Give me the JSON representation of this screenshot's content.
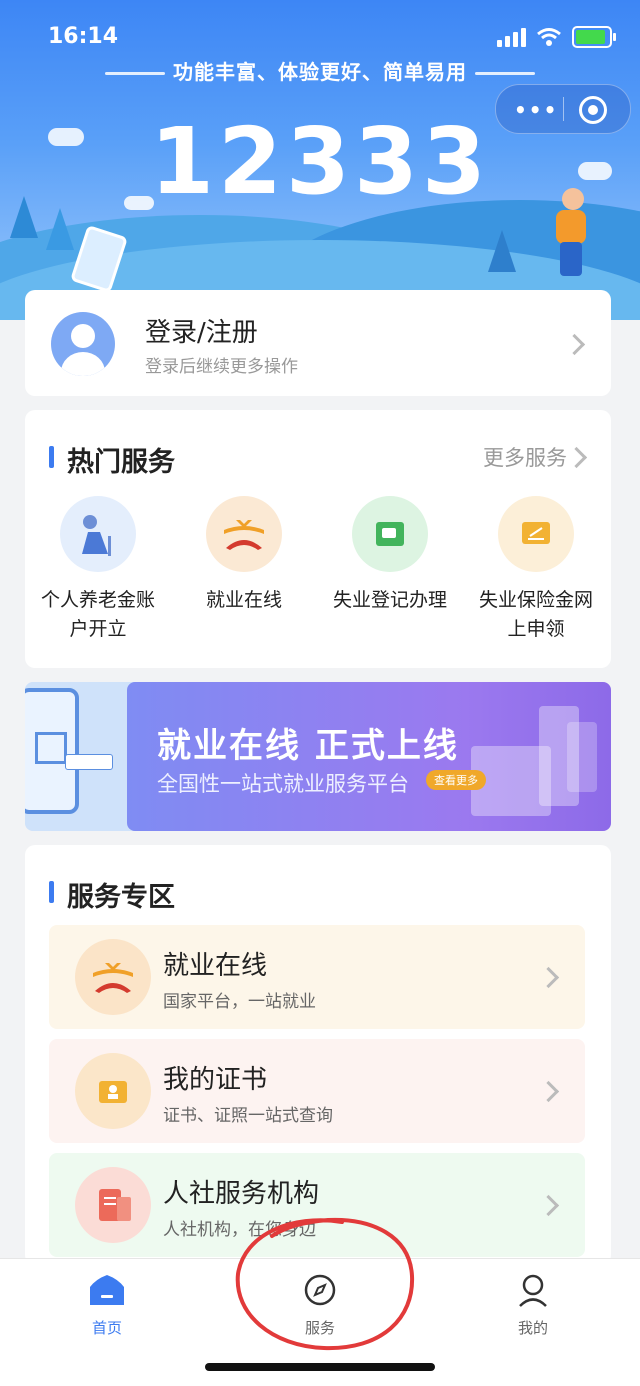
{
  "status_bar": {
    "time": "16:14"
  },
  "header": {
    "tagline": "功能丰富、体验更好、简单易用",
    "hotline": "12333",
    "capsule_dots": "•••"
  },
  "login": {
    "title": "登录/注册",
    "subtitle": "登录后继续更多操作"
  },
  "hot_services": {
    "title": "热门服务",
    "more": "更多服务",
    "items": [
      {
        "line1": "个人养老金账",
        "line2": "户开立",
        "icon": "elderly-person-icon"
      },
      {
        "line1": "就业在线",
        "line2": "",
        "icon": "employment-logo-icon"
      },
      {
        "line1": "失业登记办理",
        "line2": "",
        "icon": "wallet-icon"
      },
      {
        "line1": "失业保险金网",
        "line2": "上申领",
        "icon": "document-icon"
      }
    ]
  },
  "banner": {
    "headline": "就业在线  正式上线",
    "subline": "全国性一站式就业服务平台",
    "button": "查看更多"
  },
  "service_zone": {
    "title": "服务专区",
    "items": [
      {
        "title": "就业在线",
        "subtitle": "国家平台，一站就业",
        "icon": "employment-logo-icon",
        "bg": "#fdf6e9"
      },
      {
        "title": "我的证书",
        "subtitle": "证书、证照一站式查询",
        "icon": "certificate-icon",
        "bg": "#fdf3f1"
      },
      {
        "title": "人社服务机构",
        "subtitle": "人社机构，在您身边",
        "icon": "institution-icon",
        "bg": "#eefaf0"
      }
    ]
  },
  "tabbar": {
    "items": [
      {
        "label": "首页",
        "icon": "home-icon",
        "active": true
      },
      {
        "label": "服务",
        "icon": "compass-icon",
        "active": false
      },
      {
        "label": "我的",
        "icon": "user-icon",
        "active": false
      }
    ]
  },
  "colors": {
    "accent": "#3c7bf0",
    "annotation": "#e23a3a"
  }
}
